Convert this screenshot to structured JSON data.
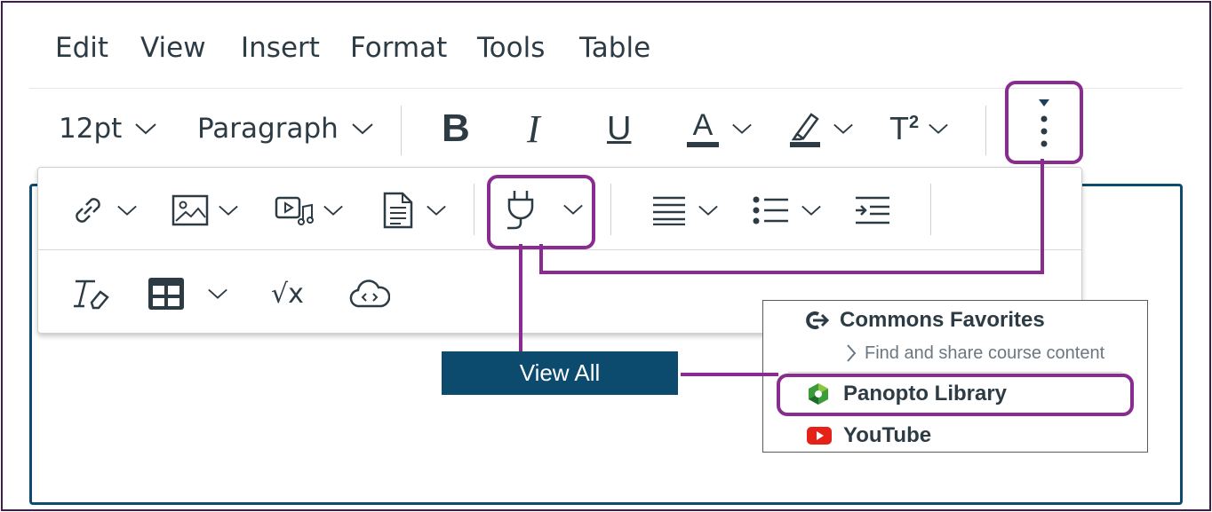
{
  "menubar": {
    "items": [
      "Edit",
      "View",
      "Insert",
      "Format",
      "Tools",
      "Table"
    ]
  },
  "toolbar": {
    "font_size": "12pt",
    "block_format": "Paragraph",
    "bold_glyph": "B",
    "italic_glyph": "I",
    "underline_glyph": "U",
    "text_color_glyph": "A",
    "superscript_glyph": "T",
    "superscript_mark": "2",
    "more_icon": "vertical-ellipsis-icon"
  },
  "popup_toolbar": {
    "row1_icons": [
      "link-icon",
      "image-icon",
      "media-icon",
      "document-icon",
      "plug-icon",
      "align-icon",
      "list-icon",
      "indent-icon"
    ],
    "row2_icons": [
      "clear-format-icon",
      "table-icon",
      "equation-icon",
      "cloud-embed-icon"
    ],
    "equation_glyph": "√x"
  },
  "callout": {
    "label": "View All"
  },
  "dropdown": {
    "commons_title": "Commons Favorites",
    "commons_sub": "Find and share course content",
    "panopto": "Panopto Library",
    "youtube": "YouTube"
  },
  "colors": {
    "highlight": "#8a2b90",
    "editor_border": "#0f4b6e",
    "callout_bg": "#0c4a6e",
    "youtube_red": "#e62117",
    "panopto_green": "#3a9d3a"
  }
}
